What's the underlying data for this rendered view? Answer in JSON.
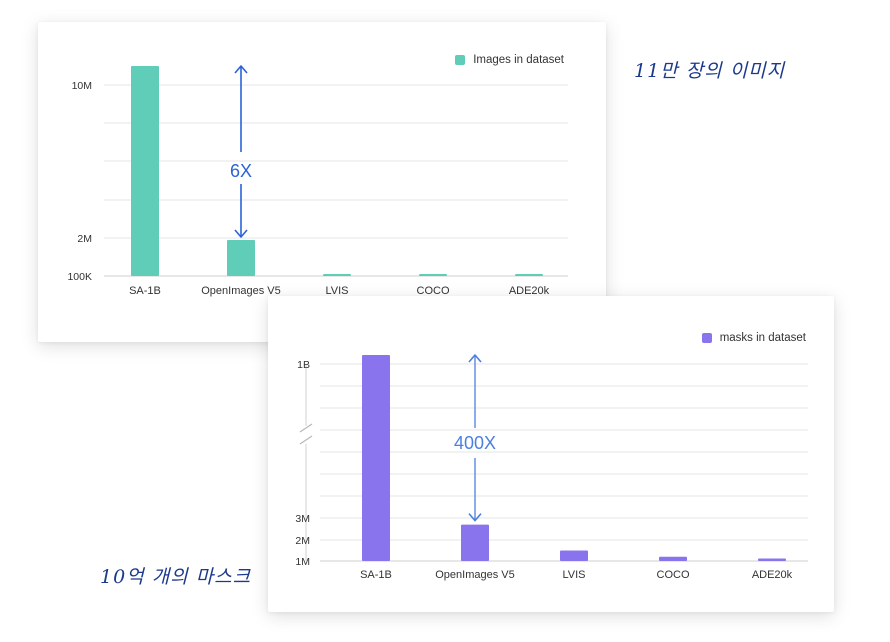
{
  "colors": {
    "images_bar": "#5fcdb8",
    "masks_bar": "#8a74ee",
    "images_arrow": "#2b63d6",
    "masks_arrow": "#4b7fe0",
    "grid": "#e6e6e6",
    "annotation_text": "#1c3a8c"
  },
  "notes": {
    "images": "11만 장의 이미지",
    "masks": "10억 개의 마스크"
  },
  "chart_data": [
    {
      "type": "bar",
      "categories": [
        "SA-1B",
        "OpenImages V5",
        "LVIS",
        "COCO",
        "ADE20k"
      ],
      "series": [
        {
          "name": "Images in dataset",
          "values": [
            11000000,
            1900000,
            164000,
            118000,
            25000
          ]
        }
      ],
      "y_ticks": [
        "100K",
        "2M",
        "10M"
      ],
      "y_axis": "broken scale: 100K, 2M, 10M",
      "grid": true,
      "legend": "top-right",
      "annotation": {
        "label": "6X",
        "from": "OpenImages V5",
        "to": "SA-1B"
      }
    },
    {
      "type": "bar",
      "categories": [
        "SA-1B",
        "OpenImages V5",
        "LVIS",
        "COCO",
        "ADE20k"
      ],
      "series": [
        {
          "name": "masks in dataset",
          "values": [
            1100000000,
            2700000,
            1500000,
            1200000,
            1100000
          ]
        }
      ],
      "y_ticks": [
        "1M",
        "2M",
        "3M",
        "1B"
      ],
      "y_axis": "broken scale: 1M, 2M, 3M, then break, 1B",
      "grid": true,
      "legend": "top-right",
      "annotation": {
        "label": "400X",
        "from": "OpenImages V5",
        "to": "SA-1B"
      }
    }
  ]
}
